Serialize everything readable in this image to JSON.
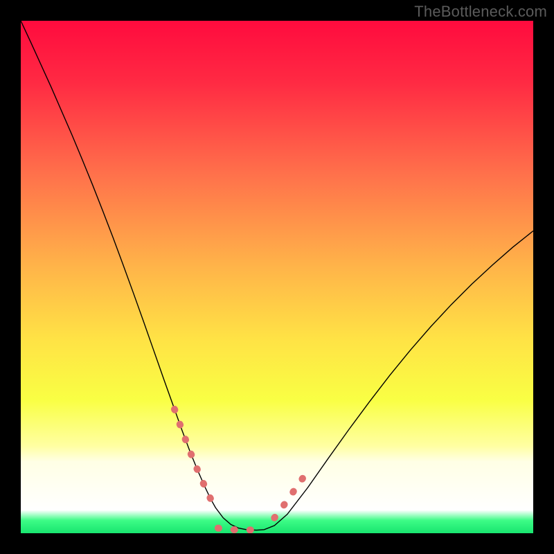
{
  "watermark": "TheBottleneck.com",
  "chart_data": {
    "type": "line",
    "title": "",
    "xlabel": "",
    "ylabel": "",
    "xlim": [
      0,
      100
    ],
    "ylim": [
      0,
      100
    ],
    "grid": false,
    "legend": false,
    "background": {
      "type": "vertical-gradient",
      "stops": [
        {
          "pos": 0.0,
          "color": "#ff0b3e"
        },
        {
          "pos": 0.12,
          "color": "#ff2a43"
        },
        {
          "pos": 0.3,
          "color": "#ff714b"
        },
        {
          "pos": 0.48,
          "color": "#ffb449"
        },
        {
          "pos": 0.62,
          "color": "#ffe245"
        },
        {
          "pos": 0.74,
          "color": "#f9ff44"
        },
        {
          "pos": 0.83,
          "color": "#ffffa2"
        },
        {
          "pos": 0.86,
          "color": "#ffffe5"
        },
        {
          "pos": 0.955,
          "color": "#ffffff"
        },
        {
          "pos": 0.975,
          "color": "#3dfc86"
        },
        {
          "pos": 1.0,
          "color": "#18e56f"
        }
      ]
    },
    "series": [
      {
        "name": "curve",
        "color": "#000000",
        "stroke_width": 1.4,
        "x": [
          0,
          2,
          4,
          6,
          8,
          10,
          12,
          14,
          16,
          18,
          20,
          22,
          24,
          26,
          28,
          30,
          31.5,
          33,
          34.5,
          36,
          37,
          38,
          39.5,
          41,
          42.5,
          44,
          46,
          47.5,
          49.5,
          52,
          56,
          60,
          64,
          68,
          72,
          76,
          80,
          84,
          88,
          92,
          96,
          100
        ],
        "y": [
          100,
          95.7,
          91.3,
          86.9,
          82.3,
          77.7,
          72.9,
          68.0,
          62.9,
          57.7,
          52.3,
          46.8,
          41.2,
          35.5,
          29.8,
          24.2,
          20.0,
          16.0,
          12.3,
          8.9,
          6.8,
          5.0,
          3.0,
          1.7,
          1.0,
          0.7,
          0.6,
          0.7,
          1.5,
          3.7,
          8.9,
          14.6,
          20.2,
          25.6,
          30.8,
          35.7,
          40.3,
          44.6,
          48.6,
          52.3,
          55.8,
          59.0
        ]
      },
      {
        "name": "highlight-left",
        "color": "#e06f6f",
        "stroke_width": 10,
        "dash": [
          1,
          22
        ],
        "linecap": "round",
        "x": [
          30,
          31.5,
          33,
          34.5,
          36,
          37,
          38
        ],
        "y": [
          24.2,
          20.0,
          16.0,
          12.3,
          8.9,
          6.8,
          5.0
        ]
      },
      {
        "name": "highlight-bottom",
        "color": "#e06f6f",
        "stroke_width": 10,
        "dash": [
          1,
          22
        ],
        "linecap": "round",
        "x": [
          38.5,
          41,
          44,
          46,
          47.5
        ],
        "y": [
          1.0,
          0.7,
          0.6,
          0.7,
          0.8
        ]
      },
      {
        "name": "highlight-right",
        "color": "#e06f6f",
        "stroke_width": 10,
        "dash": [
          1,
          22
        ],
        "linecap": "round",
        "x": [
          49.5,
          51,
          52.5,
          54,
          55.5
        ],
        "y": [
          3.0,
          5.0,
          7.1,
          9.3,
          11.4
        ]
      }
    ]
  }
}
